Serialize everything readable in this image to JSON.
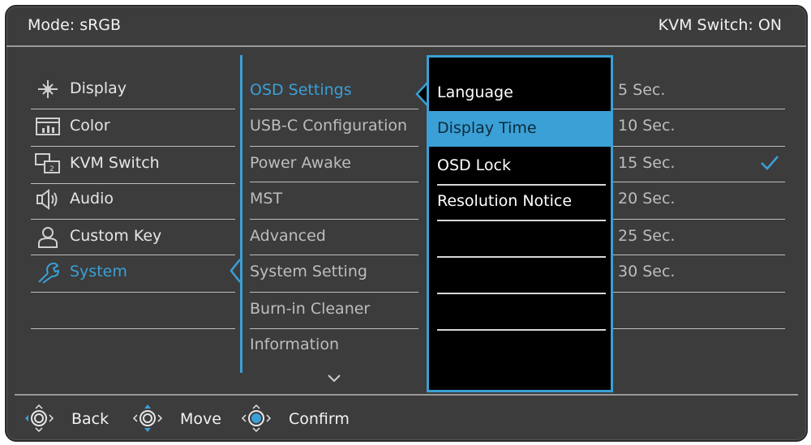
{
  "header": {
    "mode": "Mode: sRGB",
    "kvm": "KVM Switch: ON"
  },
  "left_menu": [
    {
      "label": "Display",
      "icon": "display-icon"
    },
    {
      "label": "Color",
      "icon": "color-icon"
    },
    {
      "label": "KVM Switch",
      "icon": "kvm-icon"
    },
    {
      "label": "Audio",
      "icon": "audio-icon"
    },
    {
      "label": "Custom Key",
      "icon": "person-icon"
    },
    {
      "label": "System",
      "icon": "wrench-icon",
      "active": true
    }
  ],
  "mid_menu": [
    {
      "label": "OSD Settings",
      "active": true
    },
    {
      "label": "USB-C Configuration"
    },
    {
      "label": "Power Awake"
    },
    {
      "label": "MST"
    },
    {
      "label": "Advanced"
    },
    {
      "label": "System Setting"
    },
    {
      "label": "Burn-in Cleaner"
    },
    {
      "label": "Information"
    }
  ],
  "osd_panel": [
    {
      "label": "Language"
    },
    {
      "label": "Display Time",
      "highlighted": true
    },
    {
      "label": "OSD Lock"
    },
    {
      "label": "Resolution Notice"
    }
  ],
  "display_time_options": [
    {
      "label": "5 Sec."
    },
    {
      "label": "10 Sec."
    },
    {
      "label": "15 Sec.",
      "selected": true
    },
    {
      "label": "20 Sec."
    },
    {
      "label": "25 Sec."
    },
    {
      "label": "30 Sec."
    }
  ],
  "footer": {
    "back": "Back",
    "move": "Move",
    "confirm": "Confirm"
  },
  "colors": {
    "accent": "#3aa0d6",
    "background": "#3c3c3c",
    "panel": "#000000"
  }
}
